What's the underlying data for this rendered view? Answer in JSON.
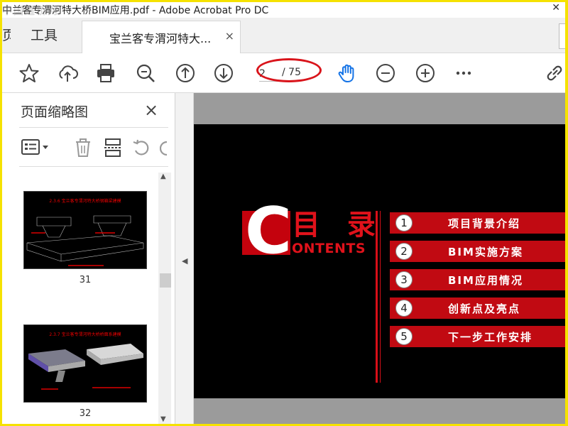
{
  "window": {
    "title": "中兰客专渭河特大桥BIM应用.pdf - Adobe Acrobat Pro DC",
    "watermark": "中国道桥网"
  },
  "tabs": {
    "home_label": "页",
    "tools_label": "工具",
    "doc_label": "宝兰客专渭河特大...",
    "doc_close": "×"
  },
  "toolbar": {
    "icons": [
      "star-icon",
      "cloud-upload-icon",
      "print-icon",
      "zoom-search-icon",
      "page-up-icon",
      "page-down-icon",
      "hand-tool-icon",
      "zoom-out-icon",
      "zoom-in-icon",
      "more-icon",
      "share-link-icon"
    ],
    "page_current": "2",
    "page_total": "/ 75"
  },
  "colors": {
    "highlight": "#d9141b",
    "slide_red": "#c10a12",
    "hand_blue": "#1473e6",
    "frame_border": "#f5e200"
  },
  "sidepanel": {
    "title": "页面缩略图",
    "close": "×",
    "thumbnails": [
      {
        "number": "31",
        "heading": "2.3.6 宝兰客专渭河特大桥钢箱梁建模"
      },
      {
        "number": "32",
        "heading": "2.3.7 宝兰客专渭河特大桥桥面系建模"
      }
    ]
  },
  "slide": {
    "big_letter": "C",
    "title": "目 录",
    "subtitle": "ONTENTS",
    "items": [
      {
        "num": "1",
        "text": "项目背景介绍"
      },
      {
        "num": "2",
        "text": "BIM实施方案"
      },
      {
        "num": "3",
        "text": "BIM应用情况"
      },
      {
        "num": "4",
        "text": "创新点及亮点"
      },
      {
        "num": "5",
        "text": "下一步工作安排"
      }
    ]
  }
}
